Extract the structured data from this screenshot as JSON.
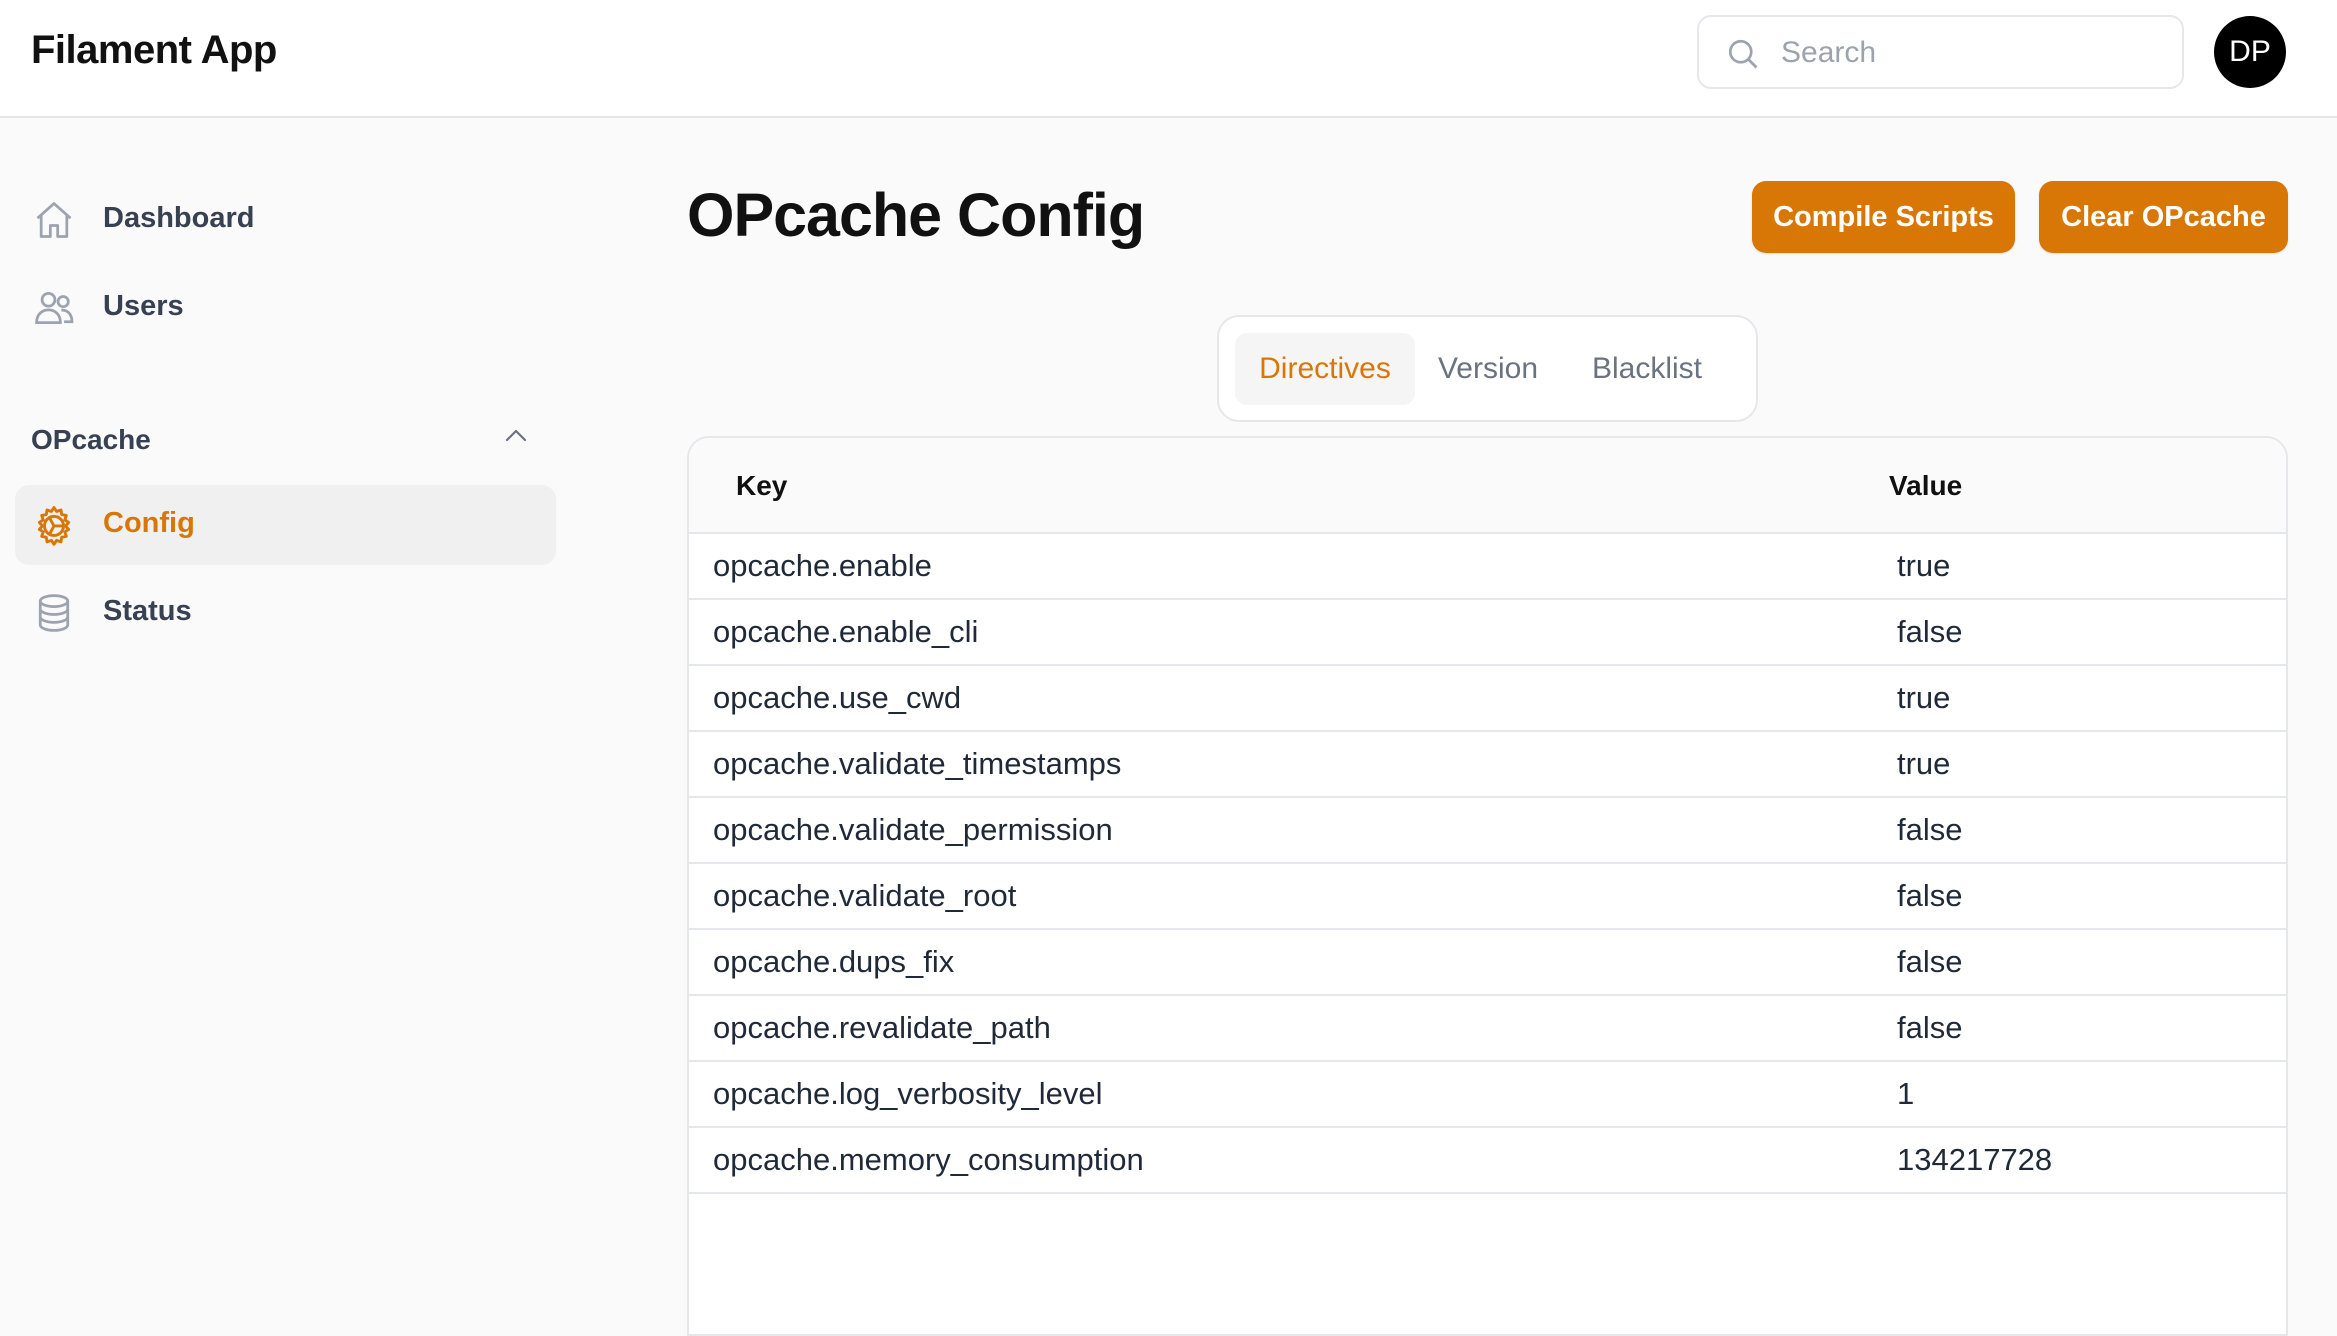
{
  "app": {
    "title": "Filament App"
  },
  "search": {
    "placeholder": "Search"
  },
  "user": {
    "initials": "DP"
  },
  "sidebar": {
    "items": [
      {
        "label": "Dashboard",
        "icon": "home-icon"
      },
      {
        "label": "Users",
        "icon": "users-icon"
      }
    ],
    "group": {
      "label": "OPcache",
      "items": [
        {
          "label": "Config",
          "icon": "cog-icon",
          "active": true
        },
        {
          "label": "Status",
          "icon": "database-icon"
        }
      ]
    }
  },
  "page": {
    "title": "OPcache Config",
    "actions": {
      "compile_label": "Compile Scripts",
      "clear_label": "Clear OPcache"
    },
    "tabs": [
      {
        "label": "Directives",
        "active": true
      },
      {
        "label": "Version"
      },
      {
        "label": "Blacklist"
      }
    ]
  },
  "table": {
    "columns": {
      "key": "Key",
      "value": "Value"
    },
    "rows": [
      {
        "key": "opcache.enable",
        "value": "true"
      },
      {
        "key": "opcache.enable_cli",
        "value": "false"
      },
      {
        "key": "opcache.use_cwd",
        "value": "true"
      },
      {
        "key": "opcache.validate_timestamps",
        "value": "true"
      },
      {
        "key": "opcache.validate_permission",
        "value": "false"
      },
      {
        "key": "opcache.validate_root",
        "value": "false"
      },
      {
        "key": "opcache.dups_fix",
        "value": "false"
      },
      {
        "key": "opcache.revalidate_path",
        "value": "false"
      },
      {
        "key": "opcache.log_verbosity_level",
        "value": "1"
      },
      {
        "key": "opcache.memory_consumption",
        "value": "134217728"
      }
    ]
  },
  "colors": {
    "accent": "#d97706",
    "background": "#fafafa",
    "border": "#e5e7eb"
  }
}
